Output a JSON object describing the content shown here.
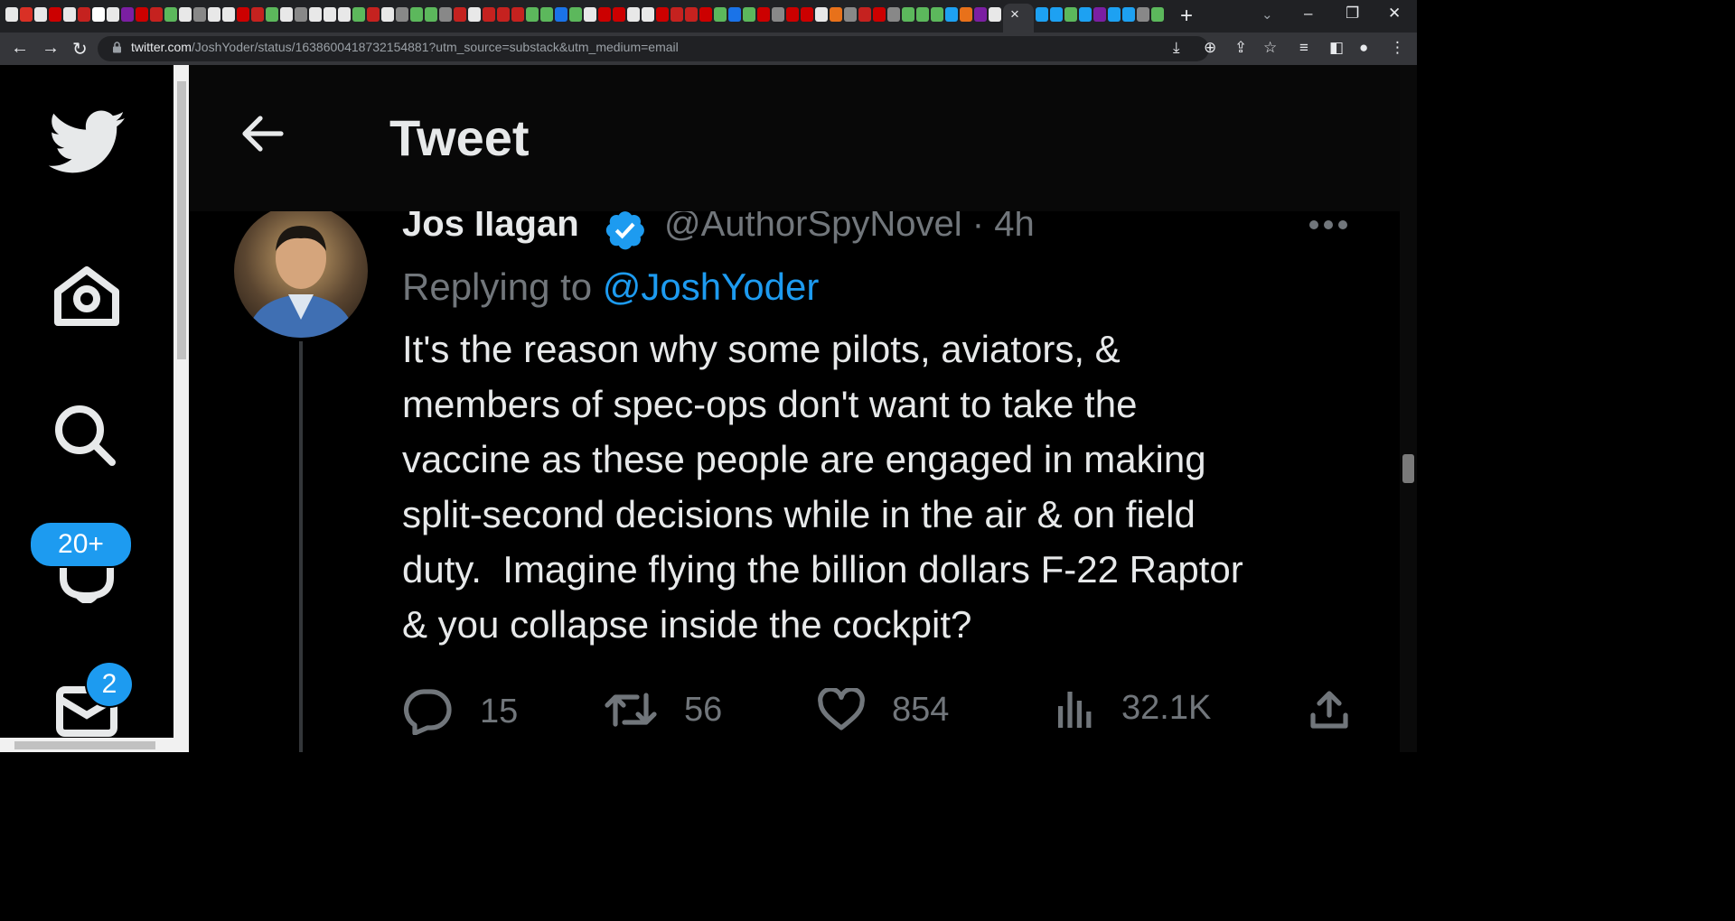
{
  "browser": {
    "url_host": "twitter.com",
    "url_path": "/JoshYoder/status/1638600418732154881?utm_source=substack&utm_medium=email",
    "active_tab_close": "×",
    "new_tab": "+",
    "tab_search": "⌄",
    "window_minimize": "–",
    "window_restore": "❐",
    "window_close": "✕",
    "nav_back": "←",
    "nav_forward": "→",
    "nav_reload": "↻"
  },
  "nav": {
    "notifications_badge": "20+",
    "messages_badge": "2"
  },
  "header": {
    "title": "Tweet"
  },
  "tweet": {
    "author_name": "Jos Ilagan",
    "handle_time": "@AuthorSpyNovel · 4h",
    "replying_prefix": "Replying to ",
    "replying_to": "@JoshYoder",
    "text": "It's the reason why some pilots, aviators, &\nmembers of spec-ops don't want to take the\nvaccine as these people are engaged in making\nsplit-second decisions while in the air & on field\nduty.  Imagine flying the billion dollars F-22 Raptor\n& you collapse inside the cockpit?",
    "replies": "15",
    "retweets": "56",
    "likes": "854",
    "views": "32.1K"
  },
  "colors": {
    "accent": "#1d9bf0",
    "text_primary": "#e7e9ea",
    "text_secondary": "#71767b",
    "background": "#000000"
  }
}
